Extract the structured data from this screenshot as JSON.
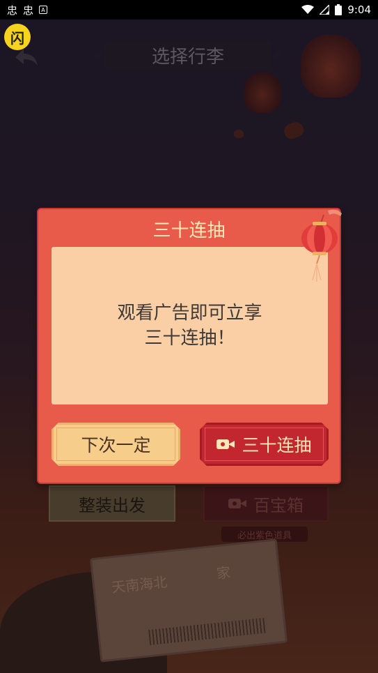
{
  "status_bar": {
    "left_icons": [
      "忠",
      "忠"
    ],
    "time": "9:04"
  },
  "app_badge": "闪",
  "header": {
    "title": "选择行李"
  },
  "background": {
    "pack_button_label": "整装出发",
    "treasure_button_label": "百宝箱",
    "treasure_subtitle": "必出紫色道具",
    "ticket_text_left": "天南海北",
    "ticket_text_right": "家"
  },
  "modal": {
    "title": "三十连抽",
    "message_line1": "观看广告即可立享",
    "message_line2": "三十连抽！",
    "next_button_label": "下次一定",
    "confirm_button_label": "三十连抽",
    "confirm_button_icon": "video-camera-icon"
  },
  "colors": {
    "modal_bg": "#e85a4a",
    "modal_body_bg": "#fbcfa5",
    "next_btn_bg": "#f6cd8a",
    "confirm_btn_bg": "#c2262f",
    "title_text": "#fde7b6"
  }
}
